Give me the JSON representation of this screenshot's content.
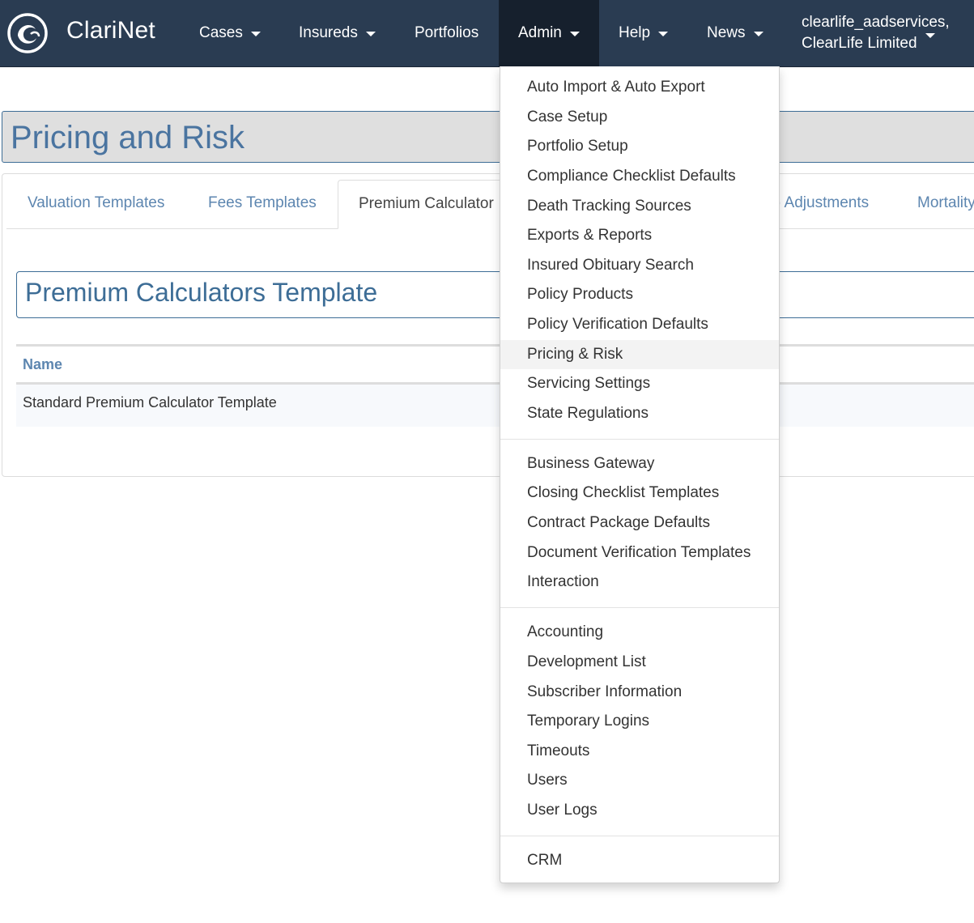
{
  "app": {
    "brand": "ClariNet"
  },
  "nav": {
    "cases": "Cases",
    "insureds": "Insureds",
    "portfolios": "Portfolios",
    "admin": "Admin",
    "help": "Help",
    "news": "News",
    "user_line1": "clearlife_aadservices,",
    "user_line2": "ClearLife Limited"
  },
  "page": {
    "title": "Pricing and Risk"
  },
  "tabs": {
    "valuation": "Valuation Templates",
    "fees": "Fees Templates",
    "premium": "Premium Calculator",
    "adjustments": ") Adjustments",
    "mortality": "Mortality"
  },
  "section": {
    "title": "Premium Calculators Template"
  },
  "table": {
    "header_name": "Name",
    "rows": [
      {
        "name": "Standard Premium Calculator Template"
      }
    ]
  },
  "admin_menu": {
    "group1": [
      "Auto Import & Auto Export",
      "Case Setup",
      "Portfolio Setup",
      "Compliance Checklist Defaults",
      "Death Tracking Sources",
      "Exports & Reports",
      "Insured Obituary Search",
      "Policy Products",
      "Policy Verification Defaults",
      "Pricing & Risk",
      "Servicing Settings",
      "State Regulations"
    ],
    "group2": [
      "Business Gateway",
      "Closing Checklist Templates",
      "Contract Package Defaults",
      "Document Verification Templates",
      "Interaction"
    ],
    "group3": [
      "Accounting",
      "Development List",
      "Subscriber Information",
      "Temporary Logins",
      "Timeouts",
      "Users",
      "User Logs"
    ],
    "group4": [
      "CRM"
    ],
    "active_item": "Pricing & Risk"
  },
  "colors": {
    "navbar": "#2a3c52",
    "nav_active": "#16202d",
    "link": "#5d86b0",
    "title": "#4a74a0"
  }
}
